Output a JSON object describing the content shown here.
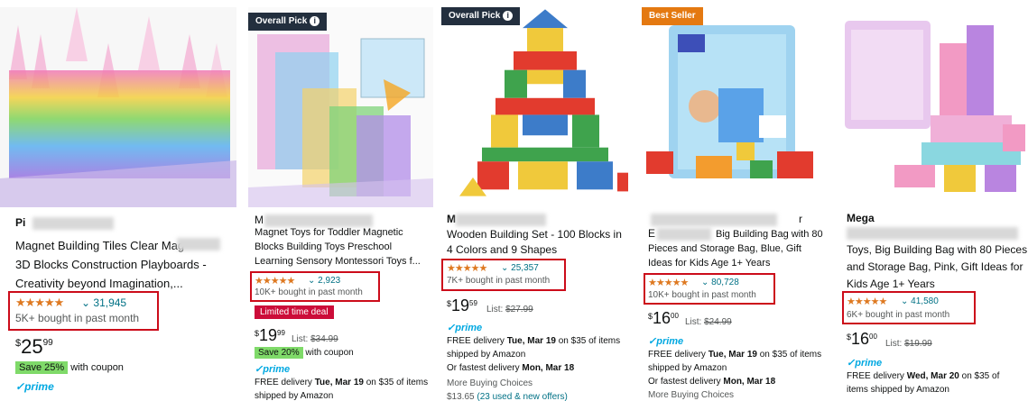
{
  "products": [
    {
      "brand": "Pi",
      "title_lines": [
        "Magnet Building Tiles Clear Mag",
        "3D Blocks Construction Playboards -",
        "Creativity beyond Imagination,..."
      ],
      "stars": "★★★★★",
      "rating_count": "31,945",
      "bought": "5K+ bought in past month",
      "price_whole": "25",
      "price_frac": "99",
      "coupon_badge": "Save 25%",
      "coupon_text": "with coupon",
      "prime": "prime"
    },
    {
      "badge": "Overall Pick",
      "brand": "M",
      "title_lines": [
        "Magnet Toys for Toddler Magnetic",
        "Blocks Building Toys Preschool",
        "Learning Sensory Montessori Toys f..."
      ],
      "stars": "★★★★★",
      "rating_count": "2,923",
      "bought": "10K+ bought in past month",
      "deal": "Limited time deal",
      "price_whole": "19",
      "price_frac": "99",
      "list_label": "List:",
      "list_price": "$34.99",
      "coupon_badge": "Save 20%",
      "coupon_text": "with coupon",
      "prime": "prime",
      "delivery": [
        "FREE delivery",
        "Tue, Mar 19",
        "on $35 of items"
      ],
      "shipped": "shipped by Amazon"
    },
    {
      "badge": "Overall Pick",
      "brand": "M",
      "title_lines": [
        "Wooden Building Set - 100 Blocks in",
        "4 Colors and 9 Shapes"
      ],
      "stars": "★★★★★",
      "rating_count": "25,357",
      "bought": "7K+ bought in past month",
      "price_whole": "19",
      "price_frac": "59",
      "list_label": "List:",
      "list_price": "$27.99",
      "prime": "prime",
      "delivery": [
        "FREE delivery",
        "Tue, Mar 19",
        "on $35 of items"
      ],
      "shipped": "shipped by Amazon",
      "fastest": [
        "Or fastest delivery",
        "Mon, Mar 18"
      ],
      "more_choices": "More Buying Choices",
      "used_price": "$13.65",
      "used_link": "(23 used & new offers)"
    },
    {
      "badge": "Best Seller",
      "brand_prefix": "E",
      "brand_suffix": "r",
      "title_lines": [
        "Big Building Bag with 80",
        "Pieces and Storage Bag, Blue, Gift",
        "Ideas for Kids Age 1+ Years"
      ],
      "stars": "★★★★★",
      "rating_count": "80,728",
      "bought": "10K+ bought in past month",
      "price_whole": "16",
      "price_frac": "00",
      "list_label": "List:",
      "list_price": "$24.99",
      "prime": "prime",
      "delivery": [
        "FREE delivery",
        "Tue, Mar 19",
        "on $35 of items"
      ],
      "shipped": "shipped by Amazon",
      "fastest": [
        "Or fastest delivery",
        "Mon, Mar 18"
      ],
      "more_choices": "More Buying Choices"
    },
    {
      "brand": "Mega",
      "title_lines": [
        "Toys, Big Building Bag with 80 Pieces",
        "and Storage Bag, Pink, Gift Ideas for",
        "Kids Age 1+ Years"
      ],
      "stars": "★★★★★",
      "rating_count": "41,580",
      "bought": "6K+ bought in past month",
      "price_whole": "16",
      "price_frac": "00",
      "list_label": "List:",
      "list_price": "$19.99",
      "prime": "prime",
      "delivery": [
        "FREE delivery",
        "Wed, Mar 20",
        "on $35 of"
      ],
      "shipped": "items shipped by Amazon"
    }
  ],
  "colors": {
    "star": "#de7921",
    "link": "#007185",
    "highlight_box": "#cc0c1a",
    "overall_pick_badge": "#232f3e",
    "best_seller_badge": "#e47911",
    "deal_badge": "#cc0c39",
    "coupon": "#7fda69",
    "prime": "#00a8e1"
  }
}
